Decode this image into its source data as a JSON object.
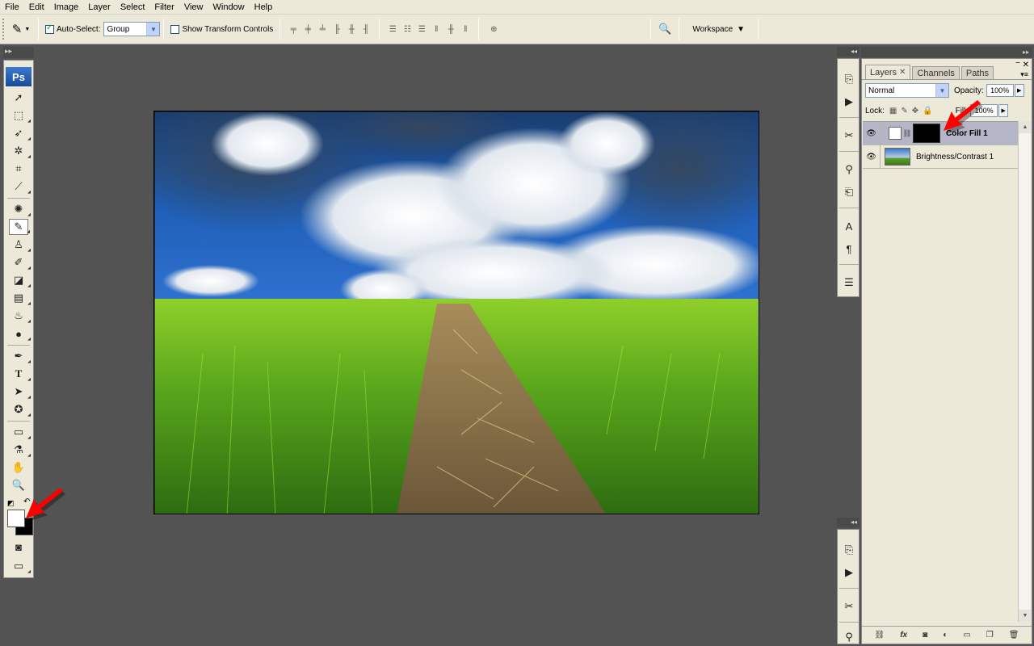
{
  "menu": [
    "File",
    "Edit",
    "Image",
    "Layer",
    "Select",
    "Filter",
    "View",
    "Window",
    "Help"
  ],
  "options_bar": {
    "auto_select_label": "Auto-Select:",
    "auto_select_checked": true,
    "auto_select_value": "Group",
    "show_transform_label": "Show Transform Controls",
    "show_transform_checked": false,
    "workspace_label": "Workspace"
  },
  "toolbox": {
    "logo": "Ps"
  },
  "layers_panel": {
    "tabs": [
      "Layers",
      "Channels",
      "Paths"
    ],
    "active_tab": "Layers",
    "blend_mode": "Normal",
    "opacity_label": "Opacity:",
    "opacity_value": "100%",
    "lock_label": "Lock:",
    "fill_label": "Fill:",
    "fill_value": "100%",
    "layers": [
      {
        "name": "Color Fill 1",
        "selected": true
      },
      {
        "name": "Brightness/Contrast 1",
        "selected": false
      }
    ]
  },
  "colors": {
    "foreground": "#ffffff",
    "background": "#000000",
    "annotation_arrow": "#ff0000"
  }
}
